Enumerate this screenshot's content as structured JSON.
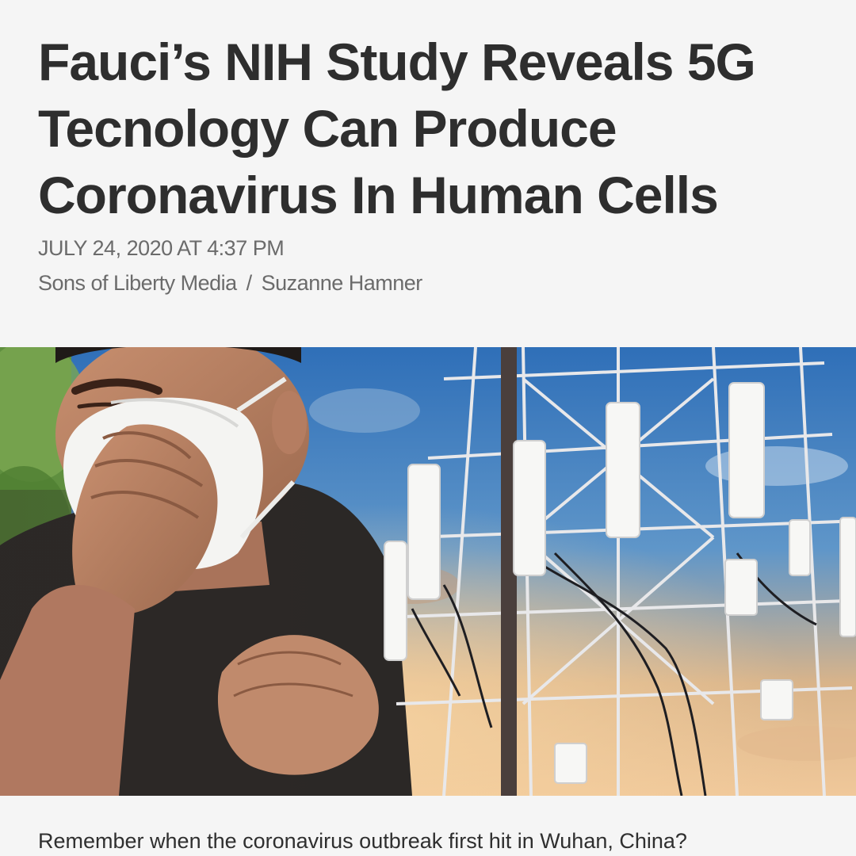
{
  "article": {
    "headline_lines": [
      "Fauci’s NIH Study Reveals 5G",
      "Tecnology Can Produce",
      "Coronavirus In Human Cells"
    ],
    "date": "JULY 24, 2020 AT 4:37 PM",
    "publisher": "Sons of Liberty Media",
    "separator": "/",
    "author": "Suzanne Hamner",
    "body_first_line": "Remember when the coronavirus outbreak first hit in Wuhan, China?"
  },
  "hero_image": {
    "description_icon": "masked-man-and-cell-tower-photo"
  },
  "colors": {
    "background": "#f5f5f5",
    "headline": "#2e2e2e",
    "meta": "#6b6b6b",
    "body": "#2f2f2f"
  }
}
